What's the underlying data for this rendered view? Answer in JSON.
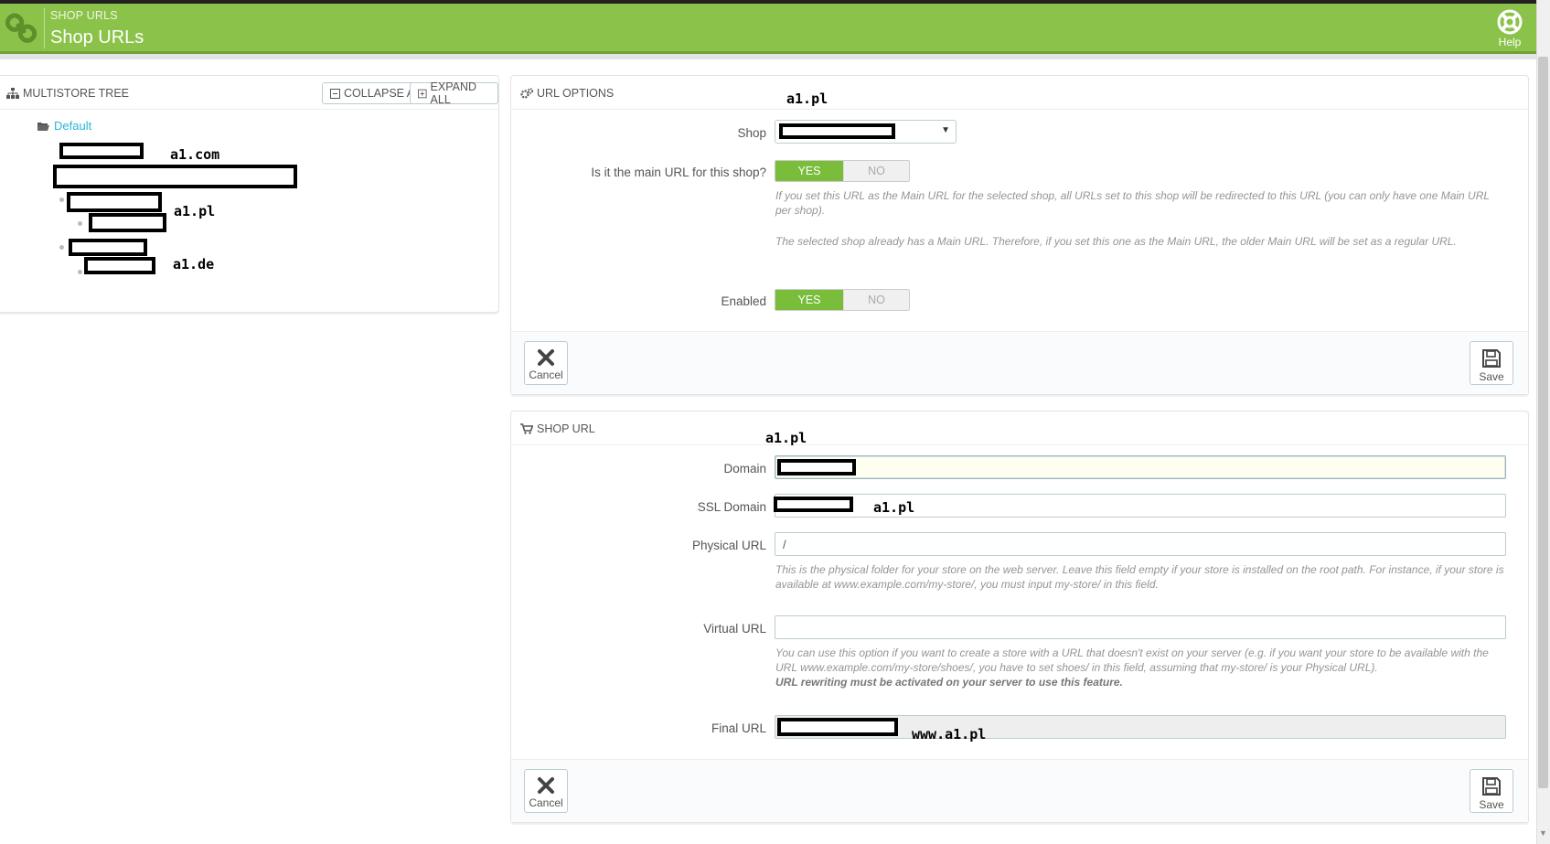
{
  "header": {
    "breadcrumb": "SHOP URLS",
    "title": "Shop URLs",
    "help_label": "Help"
  },
  "tree_panel": {
    "title": "MULTISTORE TREE",
    "collapse_label": "Collapse All",
    "expand_label": "Expand All",
    "root_label": "Default",
    "annotations": [
      "a1.com",
      "a1.pl",
      "a1.de"
    ]
  },
  "url_options": {
    "title": "URL OPTIONS",
    "annotation": "a1.pl",
    "shop_label": "Shop",
    "main_url_label": "Is it the main URL for this shop?",
    "main_url_yes": "YES",
    "main_url_no": "NO",
    "main_url_value": "YES",
    "help1": "If you set this URL as the Main URL for the selected shop, all URLs set to this shop will be redirected to this URL (you can only have one Main URL per shop).",
    "help2": "The selected shop already has a Main URL. Therefore, if you set this one as the Main URL, the older Main URL will be set as a regular URL.",
    "enabled_label": "Enabled",
    "enabled_yes": "YES",
    "enabled_no": "NO",
    "enabled_value": "YES",
    "cancel_label": "Cancel",
    "save_label": "Save"
  },
  "shop_url": {
    "title": "SHOP URL",
    "annotation": "a1.pl",
    "domain_label": "Domain",
    "ssl_domain_label": "SSL Domain",
    "ssl_annotation": "a1.pl",
    "physical_url_label": "Physical URL",
    "physical_url_value": "/",
    "physical_help": "This is the physical folder for your store on the web server. Leave this field empty if your store is installed on the root path. For instance, if your store is available at www.example.com/my-store/, you must input my-store/ in this field.",
    "virtual_url_label": "Virtual URL",
    "virtual_url_value": "",
    "virtual_help": "You can use this option if you want to create a store with a URL that doesn't exist on your server (e.g. if you want your store to be available with the URL www.example.com/my-store/shoes/, you have to set shoes/ in this field, assuming that my-store/ is your Physical URL).",
    "virtual_help_bold": "URL rewriting must be activated on your server to use this feature.",
    "final_url_label": "Final URL",
    "final_annotation": "www.a1.pl",
    "cancel_label": "Cancel",
    "save_label": "Save"
  },
  "colors": {
    "header_green": "#8bc34a",
    "toggle_green": "#79bd3a",
    "link_blue": "#25b9d7"
  }
}
